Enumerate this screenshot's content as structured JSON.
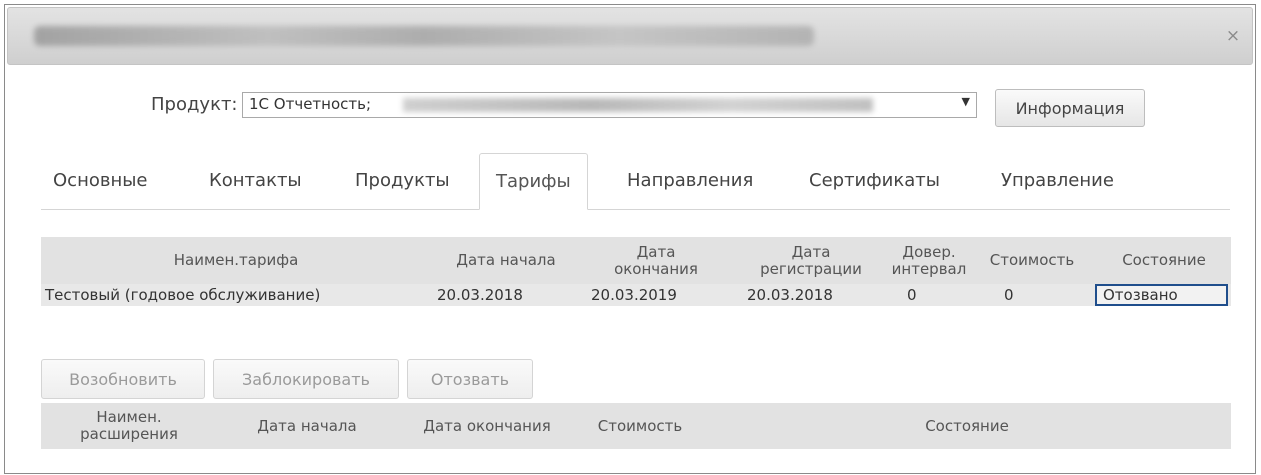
{
  "dialog": {
    "close_icon": "×"
  },
  "product": {
    "label": "Продукт:",
    "selected_value": "1С Отчетность;",
    "dropdown_arrow": "▼",
    "info_button": "Информация"
  },
  "tabs": [
    {
      "label": "Основные"
    },
    {
      "label": "Контакты"
    },
    {
      "label": "Продукты"
    },
    {
      "label": "Тарифы",
      "active": true
    },
    {
      "label": "Направления"
    },
    {
      "label": "Сертификаты"
    },
    {
      "label": "Управление"
    }
  ],
  "tariffs_table": {
    "headers": {
      "name": "Наимен.тарифа",
      "start": "Дата начала",
      "end_line1": "Дата",
      "end_line2": "окончания",
      "reg_line1": "Дата",
      "reg_line2": "регистрации",
      "trust_line1": "Довер.",
      "trust_line2": "интервал",
      "cost": "Стоимость",
      "status": "Состояние"
    },
    "rows": [
      {
        "name": "Тестовый (годовое обслуживание)",
        "start": "20.03.2018",
        "end": "20.03.2019",
        "registration": "20.03.2018",
        "trust_interval": "0",
        "cost": "0",
        "status": "Отозвано"
      }
    ]
  },
  "actions": {
    "renew": "Возобновить",
    "block": "Заблокировать",
    "revoke": "Отозвать"
  },
  "extensions_table": {
    "headers": {
      "name_line1": "Наимен.",
      "name_line2": "расширения",
      "start": "Дата начала",
      "end": "Дата окончания",
      "cost": "Стоимость",
      "status": "Состояние"
    }
  }
}
